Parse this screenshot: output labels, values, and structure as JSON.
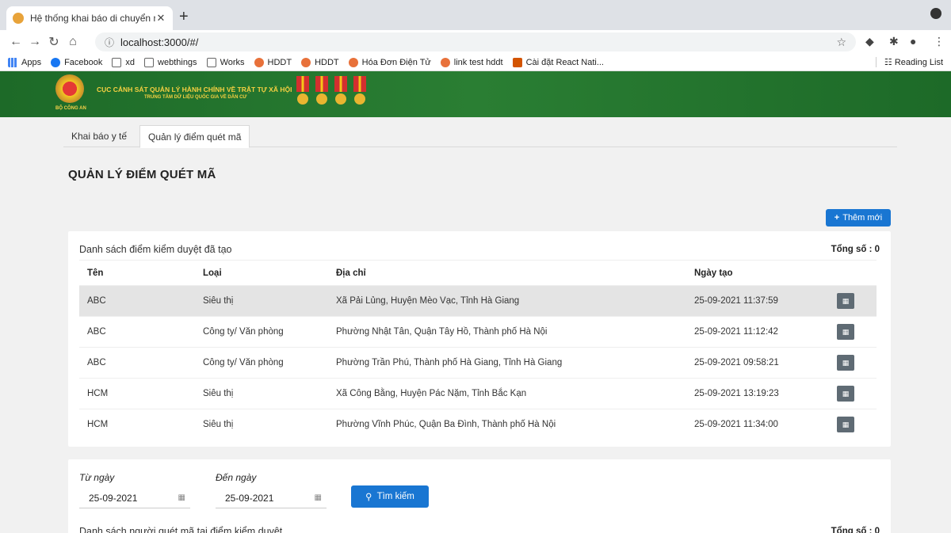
{
  "browser": {
    "tab_title": "Hệ thống khai báo di chuyển nội",
    "new_tab": "+",
    "url": "localhost:3000/#/",
    "bookmarks": [
      {
        "label": "Apps",
        "icon": "apps-icon"
      },
      {
        "label": "Facebook",
        "icon": "facebook-icon"
      },
      {
        "label": "xd",
        "icon": "folder-icon"
      },
      {
        "label": "webthings",
        "icon": "folder-icon"
      },
      {
        "label": "Works",
        "icon": "folder-icon"
      },
      {
        "label": "HDDT",
        "icon": "hddt-icon"
      },
      {
        "label": "HDDT",
        "icon": "hddt-icon"
      },
      {
        "label": "Hóa Đơn Điện Tử",
        "icon": "hddt-icon"
      },
      {
        "label": "link test hddt",
        "icon": "hddt-icon"
      },
      {
        "label": "Cài đặt React Nati...",
        "icon": "react-icon"
      }
    ],
    "reading_list": "Reading List"
  },
  "header": {
    "title": "CỤC CẢNH SÁT QUẢN LÝ HÀNH CHÍNH VỀ TRẬT TỰ XÃ HỘI",
    "subtitle": "TRUNG TÂM DỮ LIỆU QUỐC GIA VỀ DÂN CƯ",
    "emblem_caption": "BỘ CÔNG AN"
  },
  "tabs": [
    {
      "label": "Khai báo y tế",
      "active": false
    },
    {
      "label": "Quản lý điểm quét mã",
      "active": true
    }
  ],
  "page_title": "QUẢN LÝ ĐIỂM QUÉT MÃ",
  "add_button": "Thêm mới",
  "checkpoint_list": {
    "title": "Danh sách điểm kiểm duyệt đã tạo",
    "total": "Tổng số : 0",
    "columns": [
      "Tên",
      "Loại",
      "Địa chỉ",
      "Ngày tạo"
    ],
    "rows": [
      {
        "name": "ABC",
        "type": "Siêu thị",
        "address": "Xã Pải Lủng, Huyện Mèo Vạc, Tỉnh Hà Giang",
        "created": "25-09-2021 11:37:59"
      },
      {
        "name": "ABC",
        "type": "Công ty/ Văn phòng",
        "address": "Phường Nhật Tân, Quận Tây Hồ, Thành phố Hà Nội",
        "created": "25-09-2021 11:12:42"
      },
      {
        "name": "ABC",
        "type": "Công ty/ Văn phòng",
        "address": "Phường Trần Phú, Thành phố Hà Giang, Tỉnh Hà Giang",
        "created": "25-09-2021 09:58:21"
      },
      {
        "name": "HCM",
        "type": "Siêu thị",
        "address": "Xã Công Bằng, Huyện Pác Nặm, Tỉnh Bắc Kạn",
        "created": "25-09-2021 13:19:23"
      },
      {
        "name": "HCM",
        "type": "Siêu thị",
        "address": "Phường Vĩnh Phúc, Quận Ba Đình, Thành phố Hà Nội",
        "created": "25-09-2021 11:34:00"
      }
    ]
  },
  "filter": {
    "from_label": "Từ ngày",
    "from_value": "25-09-2021",
    "to_label": "Đến ngày",
    "to_value": "25-09-2021",
    "search_button": "Tìm kiếm"
  },
  "scan_list": {
    "title": "Danh sách người quét mã tại điểm kiểm duyệt",
    "total": "Tổng số : 0"
  }
}
